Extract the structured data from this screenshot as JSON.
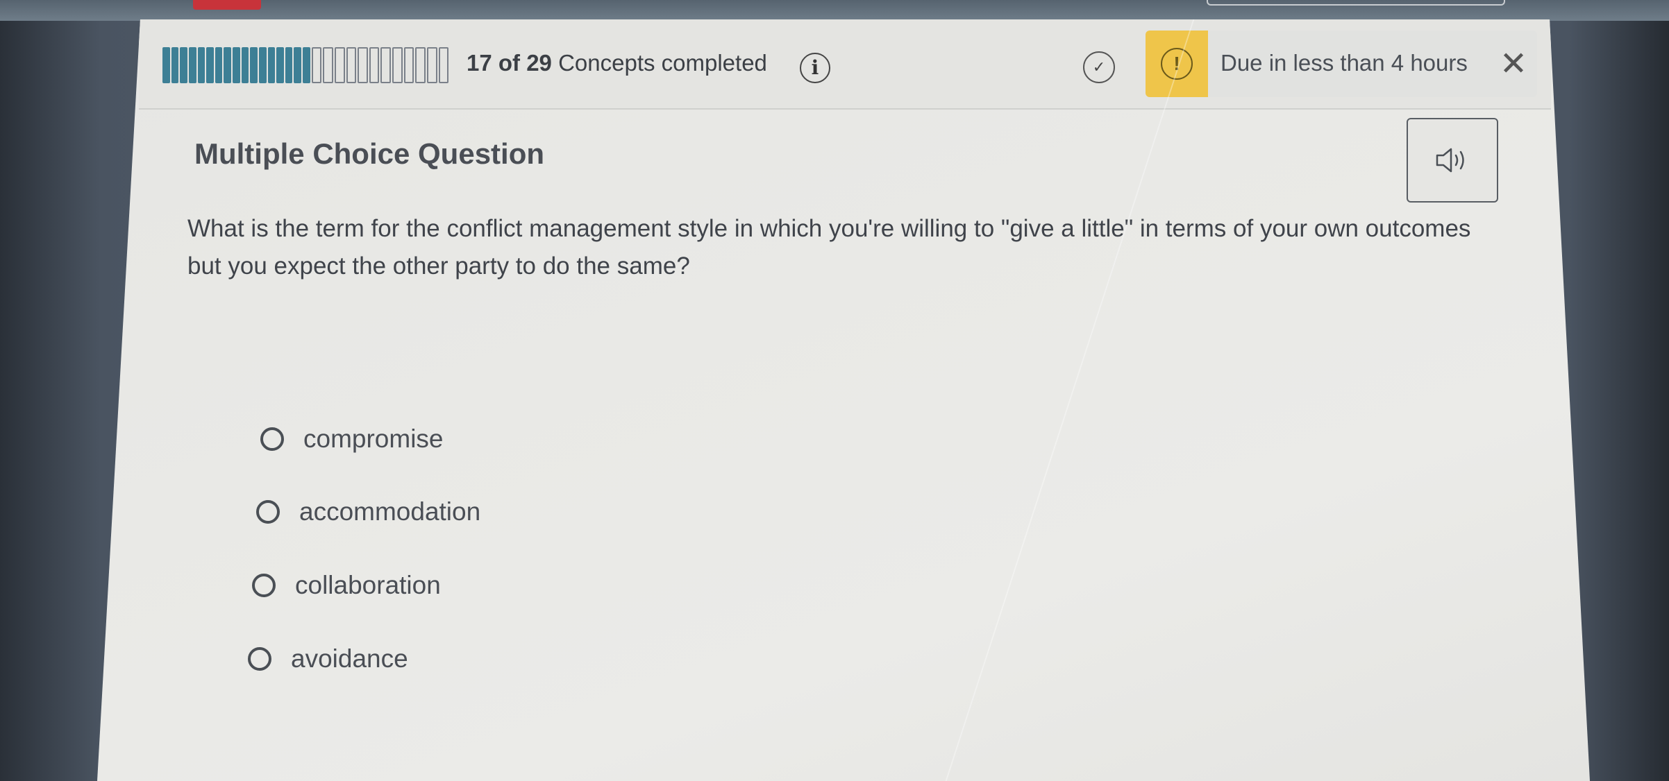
{
  "progress": {
    "completed": 17,
    "total": 29,
    "completed_text": "17 of 29",
    "suffix_text": "Concepts completed"
  },
  "icons": {
    "info": "info-icon",
    "check": "check-circle-icon",
    "warning": "warning-icon",
    "close": "close-icon",
    "audio": "speaker-icon"
  },
  "due": {
    "text": "Due in less than 4 hours"
  },
  "question": {
    "type_label": "Multiple Choice Question",
    "text": "What is the term for the conflict management style in which you're willing to \"give a little\" in terms of your own outcomes but you expect the other party to do the same?",
    "options": [
      {
        "label": "compromise"
      },
      {
        "label": "accommodation"
      },
      {
        "label": "collaboration"
      },
      {
        "label": "avoidance"
      }
    ]
  },
  "colors": {
    "progress_done": "#3d7f95",
    "warning": "#efc54a"
  }
}
